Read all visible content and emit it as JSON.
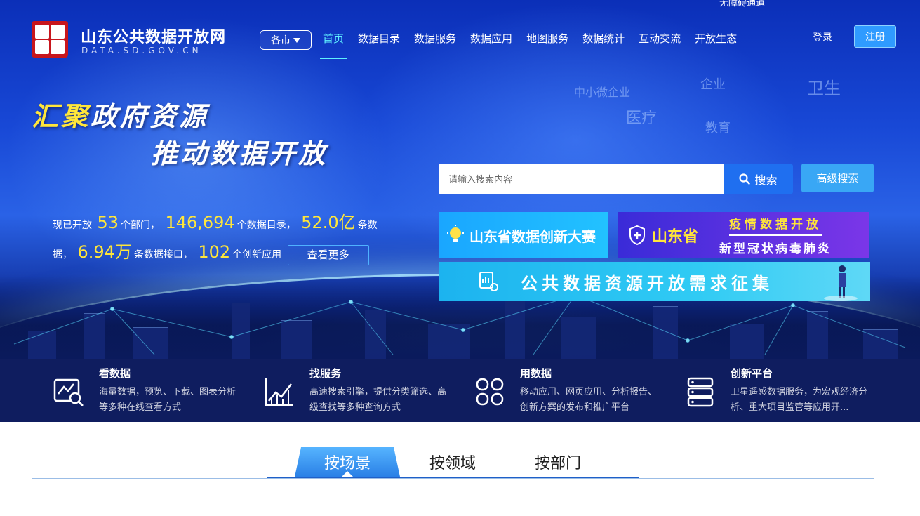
{
  "header": {
    "site_title": "山东公共数据开放网",
    "site_domain": "DATA.SD.GOV.CN",
    "city_select": "各市",
    "barrier_free": "无障碍通道",
    "nav": [
      "首页",
      "数据目录",
      "数据服务",
      "数据应用",
      "地图服务",
      "数据统计",
      "互动交流",
      "开放生态"
    ],
    "active_nav": "首页",
    "login": "登录",
    "register": "注册"
  },
  "hero": {
    "slogan_hl": "汇聚",
    "slogan_rest": "政府资源",
    "slogan_line2": "推动数据开放",
    "keywords": [
      "中小微企业",
      "企业",
      "卫生",
      "医疗",
      "教育"
    ]
  },
  "search": {
    "placeholder": "请输入搜索内容",
    "button": "搜索",
    "advanced": "高级搜索"
  },
  "stats": {
    "prefix": "现已开放",
    "departments": "53",
    "departments_unit": "个部门，",
    "catalogs": "146,694",
    "catalogs_unit": "个数据目录，",
    "records": "52.0亿",
    "records_unit": "条数据，",
    "apis": "6.94万",
    "apis_unit": "条数据接口，",
    "apps": "102",
    "apps_unit": "个创新应用",
    "more": "查看更多"
  },
  "banners": {
    "contest": "山东省数据创新大赛",
    "epidemic_province": "山东省",
    "epidemic_top": "疫情数据开放",
    "epidemic_bottom": "新型冠状病毒肺炎",
    "demand": "公共数据资源开放需求征集"
  },
  "features": [
    {
      "icon": "chart-search-icon",
      "title": "看数据",
      "desc": "海量数据，预览、下载、图表分析等多种在线查看方式"
    },
    {
      "icon": "trend-chart-icon",
      "title": "找服务",
      "desc": "高速搜索引擎，提供分类筛选、高级查找等多种查询方式"
    },
    {
      "icon": "grid-apps-icon",
      "title": "用数据",
      "desc": "移动应用、网页应用、分析报告、创新方案的发布和推广平台"
    },
    {
      "icon": "server-icon",
      "title": "创新平台",
      "desc": "卫星遥感数据服务，为宏观经济分析、重大项目监管等应用开..."
    }
  ],
  "tabs": [
    "按场景",
    "按领域",
    "按部门"
  ],
  "colors": {
    "accent": "#1f6ff0",
    "highlight": "#ffe63a",
    "nav_active": "#5ff0ff",
    "feature_bg": "#0f1d5f"
  }
}
